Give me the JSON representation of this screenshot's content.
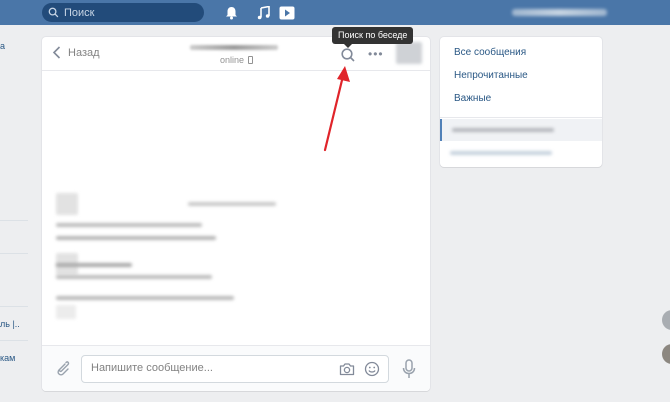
{
  "topbar": {
    "search_placeholder": "Поиск",
    "icons": [
      "search-icon",
      "bell-icon",
      "music-icon",
      "play-icon"
    ]
  },
  "leftnav": {
    "fragments": [
      "а",
      "ль |..",
      "кам"
    ]
  },
  "chat": {
    "back_label": "Назад",
    "status": "online",
    "tooltip": "Поиск по беседе",
    "more_label": "•••",
    "composer_placeholder": "Напишите сообщение..."
  },
  "sidebar": {
    "items": [
      {
        "label": "Все сообщения"
      },
      {
        "label": "Непрочитанные"
      },
      {
        "label": "Важные"
      }
    ]
  },
  "colors": {
    "accent": "#4a76a8",
    "link": "#2a5885",
    "arrow": "#e0242a"
  }
}
